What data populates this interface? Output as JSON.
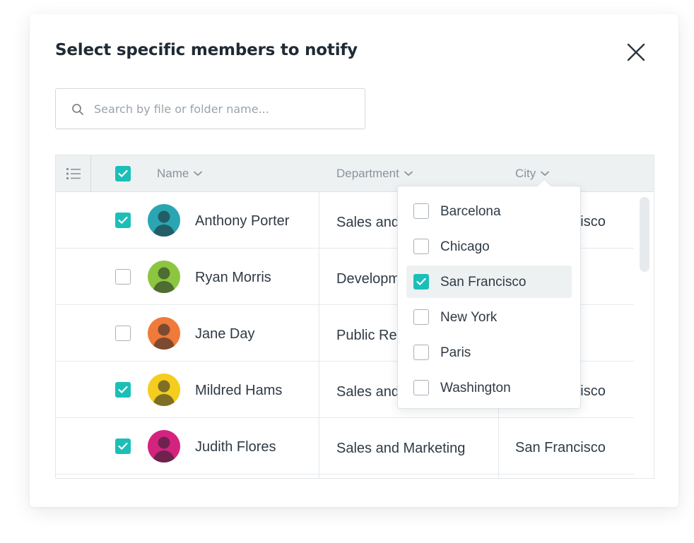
{
  "dialog": {
    "title": "Select specific members to notify"
  },
  "search": {
    "placeholder": "Search by file or folder name..."
  },
  "table": {
    "columns": [
      "Name",
      "Department",
      "City"
    ],
    "select_all": true,
    "rows": [
      {
        "name": "Anthony Porter",
        "department": "Sales and Marketing",
        "city": "San Francisco",
        "selected": true,
        "avatar_color": "#2aa6b3"
      },
      {
        "name": "Ryan Morris",
        "department": "Development",
        "city": "",
        "selected": false,
        "avatar_color": "#8cc641"
      },
      {
        "name": "Jane Day",
        "department": "Public Relations",
        "city": "",
        "selected": false,
        "avatar_color": "#f07a3a"
      },
      {
        "name": "Mildred Hams",
        "department": "Sales and Marketing",
        "city": "San Francisco",
        "selected": true,
        "avatar_color": "#f5cd1f"
      },
      {
        "name": "Judith Flores",
        "department": "Sales and Marketing",
        "city": "San Francisco",
        "selected": true,
        "avatar_color": "#d4237f"
      }
    ]
  },
  "city_filter": {
    "options": [
      {
        "label": "Barcelona",
        "checked": false
      },
      {
        "label": "Chicago",
        "checked": false
      },
      {
        "label": "San Francisco",
        "checked": true
      },
      {
        "label": "New York",
        "checked": false
      },
      {
        "label": "Paris",
        "checked": false
      },
      {
        "label": "Washington",
        "checked": false
      }
    ]
  },
  "colors": {
    "accent": "#1bbfb8",
    "header_bg": "#eef1f2",
    "text": "#2f3a45"
  },
  "icons": {
    "close": "close-icon",
    "search": "search-icon",
    "list": "list-icon",
    "sort": "chevron-down-icon",
    "check": "check-icon"
  }
}
